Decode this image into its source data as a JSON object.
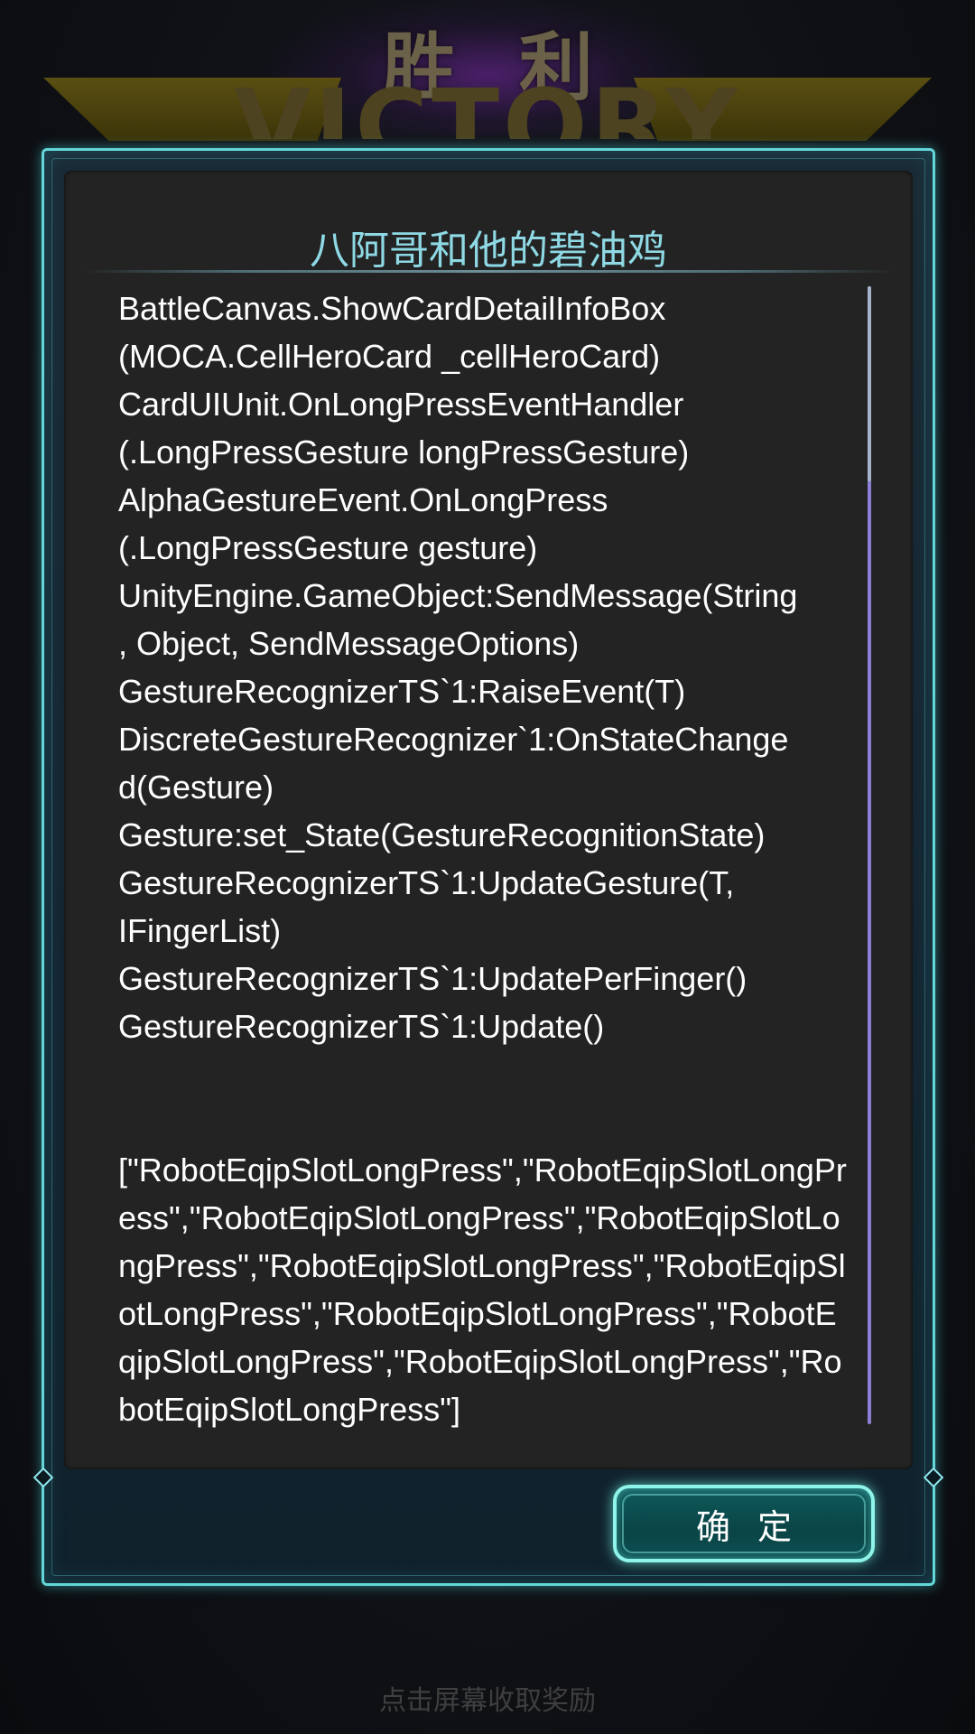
{
  "banner": {
    "title_cn": "胜利",
    "title_en": "VICTORY"
  },
  "dialog": {
    "title": "八阿哥和他的碧油鸡",
    "log_lines": [
      "BattleCanvas.ShowCardDetailInfoBox",
      "(MOCA.CellHeroCard _cellHeroCard)",
      "CardUIUnit.OnLongPressEventHandler",
      "(.LongPressGesture longPressGesture)",
      "AlphaGestureEvent.OnLongPress",
      "(.LongPressGesture gesture)",
      "UnityEngine.GameObject:SendMessage(String",
      ", Object, SendMessageOptions)",
      "GestureRecognizerTS`1:RaiseEvent(T)",
      "DiscreteGestureRecognizer`1:OnStateChange",
      "d(Gesture)",
      "Gesture:set_State(GestureRecognitionState)",
      "GestureRecognizerTS`1:UpdateGesture(T,",
      "IFingerList)",
      "GestureRecognizerTS`1:UpdatePerFinger()",
      "GestureRecognizerTS`1:Update()"
    ],
    "log_footer": "[\"RobotEqipSlotLongPress\",\"RobotEqipSlotLongPress\",\"RobotEqipSlotLongPress\",\"RobotEqipSlotLongPress\",\"RobotEqipSlotLongPress\",\"RobotEqipSlotLongPress\",\"RobotEqipSlotLongPress\",\"RobotEqipSlotLongPress\",\"RobotEqipSlotLongPress\",\"RobotEqipSlotLongPress\"]",
    "confirm_label": "确定"
  },
  "hint": "点击屏幕收取奖励",
  "colors": {
    "frame": "#63d6d8",
    "title": "#8ed9e4",
    "scrollbar": "#8a7fd4",
    "button_border": "#8ff4ea"
  }
}
